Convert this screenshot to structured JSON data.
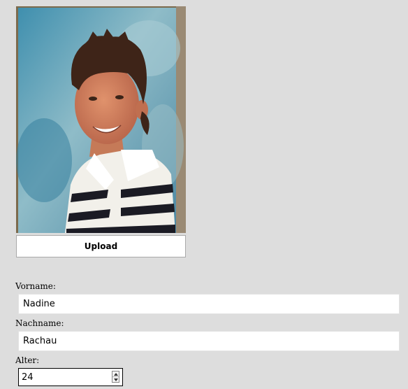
{
  "upload": {
    "label": "Upload"
  },
  "form": {
    "first_name": {
      "label": "Vorname:",
      "value": "Nadine"
    },
    "last_name": {
      "label": "Nachname:",
      "value": "Rachau"
    },
    "age": {
      "label": "Alter:",
      "value": "24"
    }
  }
}
